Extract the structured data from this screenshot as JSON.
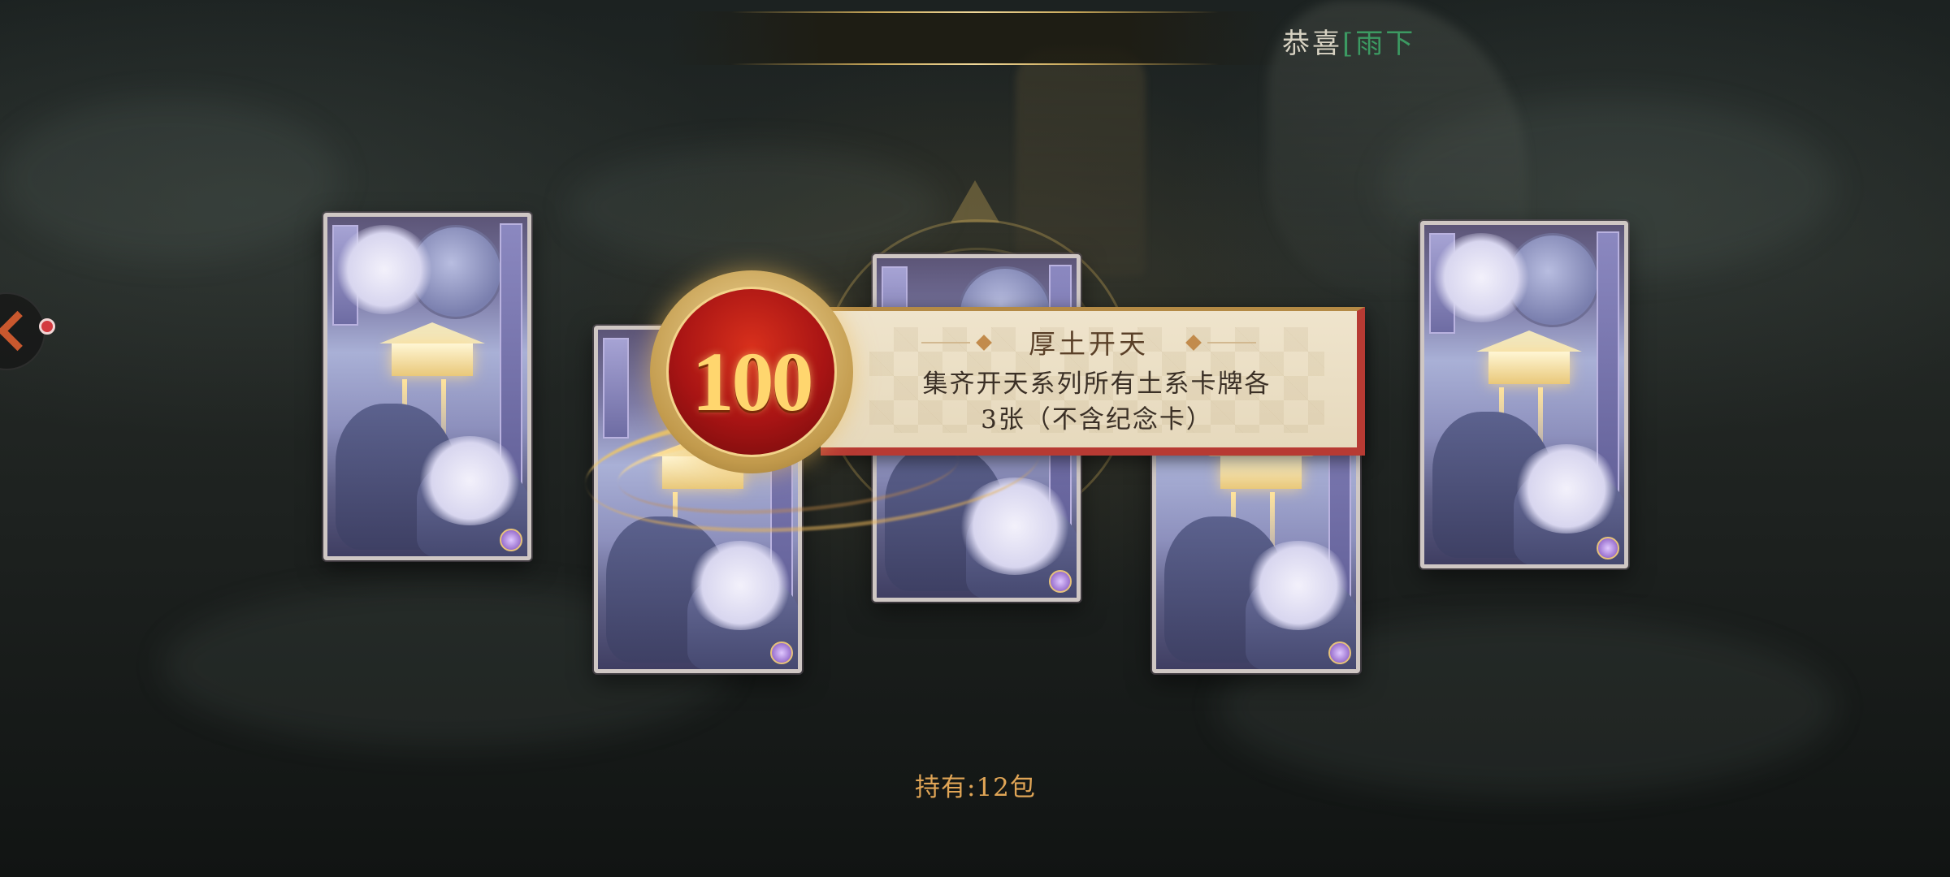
{
  "header": {
    "congrats_label": "恭喜",
    "player_name": "[雨下"
  },
  "achievement": {
    "points": "100",
    "title": "厚土开天",
    "description_line1": "集齐开天系列所有土系卡牌各",
    "description_line2": "3张（不含纪念卡）"
  },
  "cards": [
    {
      "name": "card-1"
    },
    {
      "name": "card-2"
    },
    {
      "name": "card-3"
    },
    {
      "name": "card-4"
    },
    {
      "name": "card-5"
    }
  ],
  "footer": {
    "holding_text": "持有:12包"
  },
  "icons": {
    "side_button": "chevron-icon",
    "notification": "red-dot-badge"
  },
  "colors": {
    "player_name": "#3c9a62",
    "holding_text": "#e0a556",
    "medal_red": "#a81414",
    "plaque_border": "#b73a33"
  }
}
